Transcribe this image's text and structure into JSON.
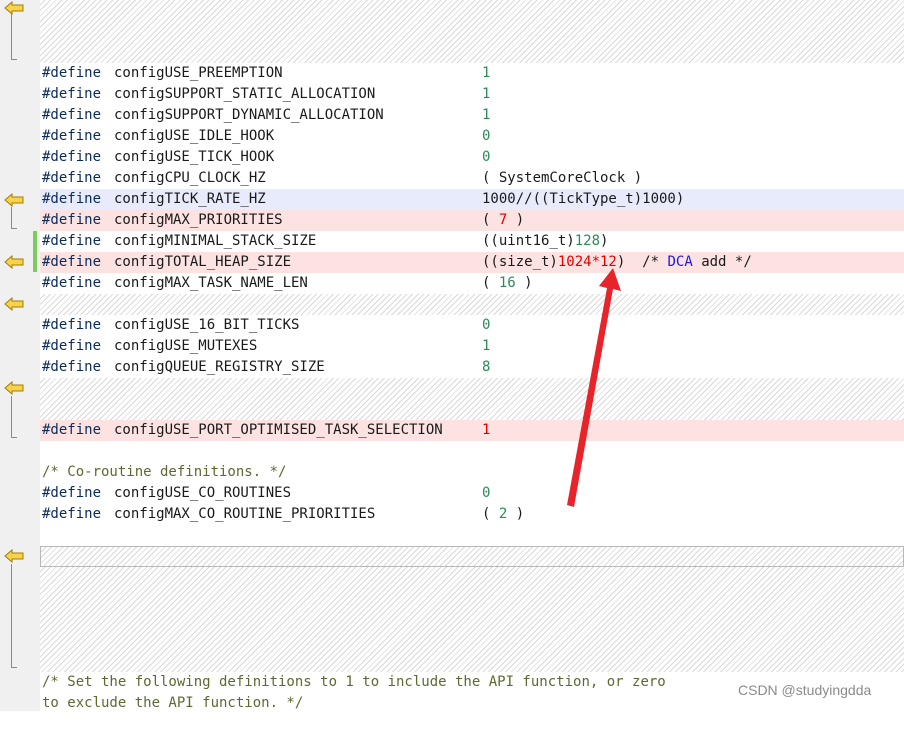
{
  "defines_block1": [
    {
      "kw": "#define",
      "name": "configUSE_PREEMPTION",
      "value": "1"
    },
    {
      "kw": "#define",
      "name": "configSUPPORT_STATIC_ALLOCATION",
      "value": "1"
    },
    {
      "kw": "#define",
      "name": "configSUPPORT_DYNAMIC_ALLOCATION",
      "value": "1"
    },
    {
      "kw": "#define",
      "name": "configUSE_IDLE_HOOK",
      "value": "0"
    },
    {
      "kw": "#define",
      "name": "configUSE_TICK_HOOK",
      "value": "0"
    },
    {
      "kw": "#define",
      "name": "configCPU_CLOCK_HZ",
      "value": "( SystemCoreClock )"
    },
    {
      "kw": "#define",
      "name": "configTICK_RATE_HZ",
      "value": "1000//((TickType_t)1000)"
    },
    {
      "kw": "#define",
      "name": "configMAX_PRIORITIES",
      "value_a": "( ",
      "value_b": "7",
      "value_c": " )"
    },
    {
      "kw": "#define",
      "name": "configMINIMAL_STACK_SIZE",
      "value_a": "((uint16_t)",
      "value_b": "128",
      "value_c": ")"
    },
    {
      "kw": "#define",
      "name": "configTOTAL_HEAP_SIZE",
      "value_a": "((size_t)",
      "value_b": "1024*12",
      "value_c": ")  ",
      "comment_a": "/* ",
      "comment_b": "DCA",
      "comment_c": " add */"
    },
    {
      "kw": "#define",
      "name": "configMAX_TASK_NAME_LEN",
      "value_a": "( ",
      "value_b": "16",
      "value_c": " )"
    }
  ],
  "defines_block2": [
    {
      "kw": "#define",
      "name": "configUSE_16_BIT_TICKS",
      "value": "0"
    },
    {
      "kw": "#define",
      "name": "configUSE_MUTEXES",
      "value": "1"
    },
    {
      "kw": "#define",
      "name": "configQUEUE_REGISTRY_SIZE",
      "value": "8"
    }
  ],
  "port_define": {
    "kw": "#define",
    "name": "configUSE_PORT_OPTIMISED_TASK_SELECTION",
    "value": "1"
  },
  "coroutine_comment": "/* Co-routine definitions. */",
  "defines_block3": [
    {
      "kw": "#define",
      "name": "configUSE_CO_ROUTINES",
      "value": "0"
    },
    {
      "kw": "#define",
      "name": "configMAX_CO_ROUTINE_PRIORITIES",
      "value_a": "( ",
      "value_b": "2",
      "value_c": " )"
    }
  ],
  "bottom_comment": [
    "/* Set the following definitions to 1 to include the API function, or zero",
    "to exclude the API function. */"
  ],
  "watermark": "CSDN @studyingdda",
  "colors": {
    "arrow": "#e8242b",
    "deleted_line_bg": "#fde2e2",
    "changed_line_bg": "#e8ebfb",
    "number": "#2e8b57"
  },
  "icons": [
    "diff-arrow-icon"
  ]
}
